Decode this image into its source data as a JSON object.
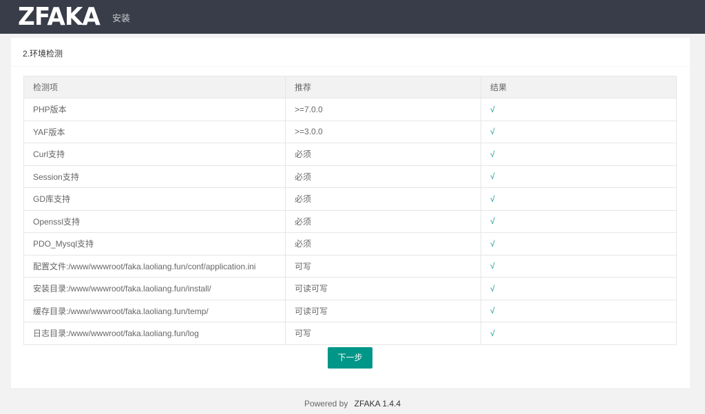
{
  "header": {
    "logo": "ZFAKA",
    "nav": "安装"
  },
  "card": {
    "title": "2.环境检测"
  },
  "table": {
    "headers": [
      "检测项",
      "推荐",
      "结果"
    ],
    "rows": [
      [
        "PHP版本",
        ">=7.0.0",
        "√"
      ],
      [
        "YAF版本",
        ">=3.0.0",
        "√"
      ],
      [
        "Curl支持",
        "必须",
        "√"
      ],
      [
        "Session支持",
        "必须",
        "√"
      ],
      [
        "GD库支持",
        "必须",
        "√"
      ],
      [
        "Openssl支持",
        "必须",
        "√"
      ],
      [
        "PDO_Mysql支持",
        "必须",
        "√"
      ],
      [
        "配置文件:/www/wwwroot/faka.laoliang.fun/conf/application.ini",
        "可写",
        "√"
      ],
      [
        "安装目录:/www/wwwroot/faka.laoliang.fun/install/",
        "可读可写",
        "√"
      ],
      [
        "缓存目录:/www/wwwroot/faka.laoliang.fun/temp/",
        "可读可写",
        "√"
      ],
      [
        "日志目录:/www/wwwroot/faka.laoliang.fun/log",
        "可写",
        "√"
      ]
    ]
  },
  "next_button": "下一步",
  "footer": {
    "powered": "Powered by",
    "brand": "ZFAKA 1.4.4"
  }
}
